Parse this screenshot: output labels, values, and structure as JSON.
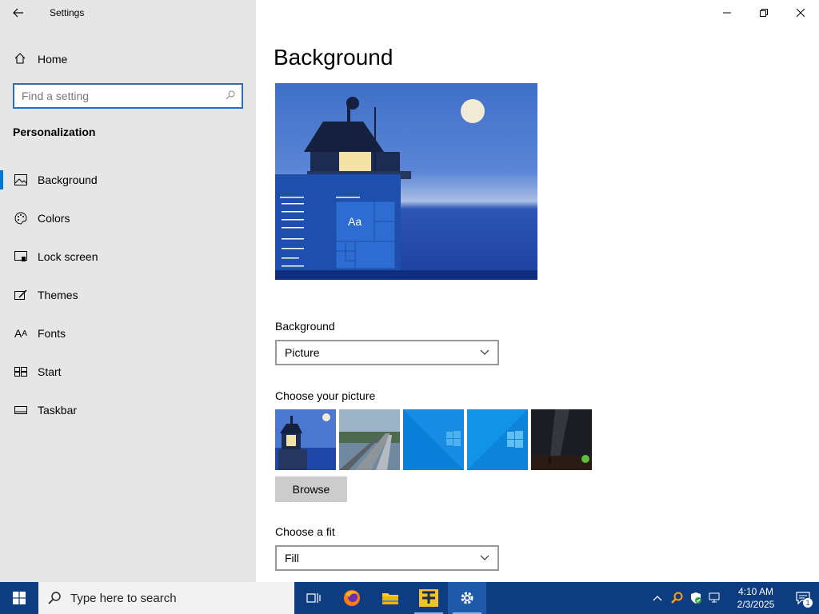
{
  "window": {
    "app_title": "Settings",
    "controls": [
      "minimize",
      "restore",
      "close"
    ]
  },
  "sidebar": {
    "home_label": "Home",
    "search_placeholder": "Find a setting",
    "section_title": "Personalization",
    "items": [
      {
        "label": "Background",
        "icon": "picture-icon",
        "active": true
      },
      {
        "label": "Colors",
        "icon": "palette-icon",
        "active": false
      },
      {
        "label": "Lock screen",
        "icon": "lock-screen-icon",
        "active": false
      },
      {
        "label": "Themes",
        "icon": "themes-icon",
        "active": false
      },
      {
        "label": "Fonts",
        "icon": "fonts-icon",
        "active": false
      },
      {
        "label": "Start",
        "icon": "start-icon",
        "active": false
      },
      {
        "label": "Taskbar",
        "icon": "taskbar-icon",
        "active": false
      }
    ]
  },
  "main": {
    "page_title": "Background",
    "preview_sample_text": "Aa",
    "background_label": "Background",
    "background_value": "Picture",
    "choose_picture_label": "Choose your picture",
    "thumbnails": [
      "lighthouse",
      "railway",
      "windows-blue-1",
      "windows-blue-2",
      "night-sky"
    ],
    "browse_label": "Browse",
    "fit_label": "Choose a fit",
    "fit_value": "Fill"
  },
  "taskbar": {
    "search_placeholder": "Type here to search",
    "apps": [
      "task-view",
      "firefox",
      "file-explorer",
      "app-yellow",
      "settings"
    ],
    "clock_time": "4:10 AM",
    "clock_date": "2/3/2025",
    "notification_count": "1"
  },
  "colors": {
    "accent": "#0078d7",
    "sidebar_bg": "#e6e6e6",
    "taskbar_bg": "#0e3c80",
    "search_border": "#2b6bc2"
  }
}
